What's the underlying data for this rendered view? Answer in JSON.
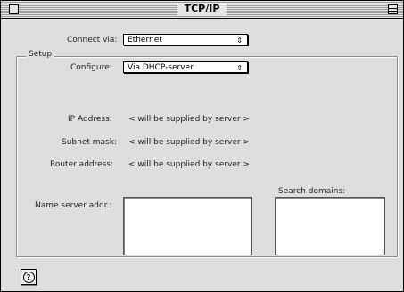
{
  "window": {
    "title": "TCP/IP"
  },
  "connect": {
    "label": "Connect via:",
    "value": "Ethernet"
  },
  "setup": {
    "title": "Setup",
    "configure": {
      "label": "Configure:",
      "value": "Via DHCP-server"
    },
    "ip_address": {
      "label": "IP Address:",
      "value": "< will be supplied by server >"
    },
    "subnet_mask": {
      "label": "Subnet mask:",
      "value": "< will be supplied by server >"
    },
    "router_address": {
      "label": "Router address:",
      "value": "< will be supplied by server >"
    },
    "name_server": {
      "label": "Name server addr.:",
      "value": ""
    },
    "search_domains": {
      "label": "Search domains:",
      "value": ""
    }
  },
  "help": {
    "icon": "help-icon",
    "glyph": "?"
  }
}
